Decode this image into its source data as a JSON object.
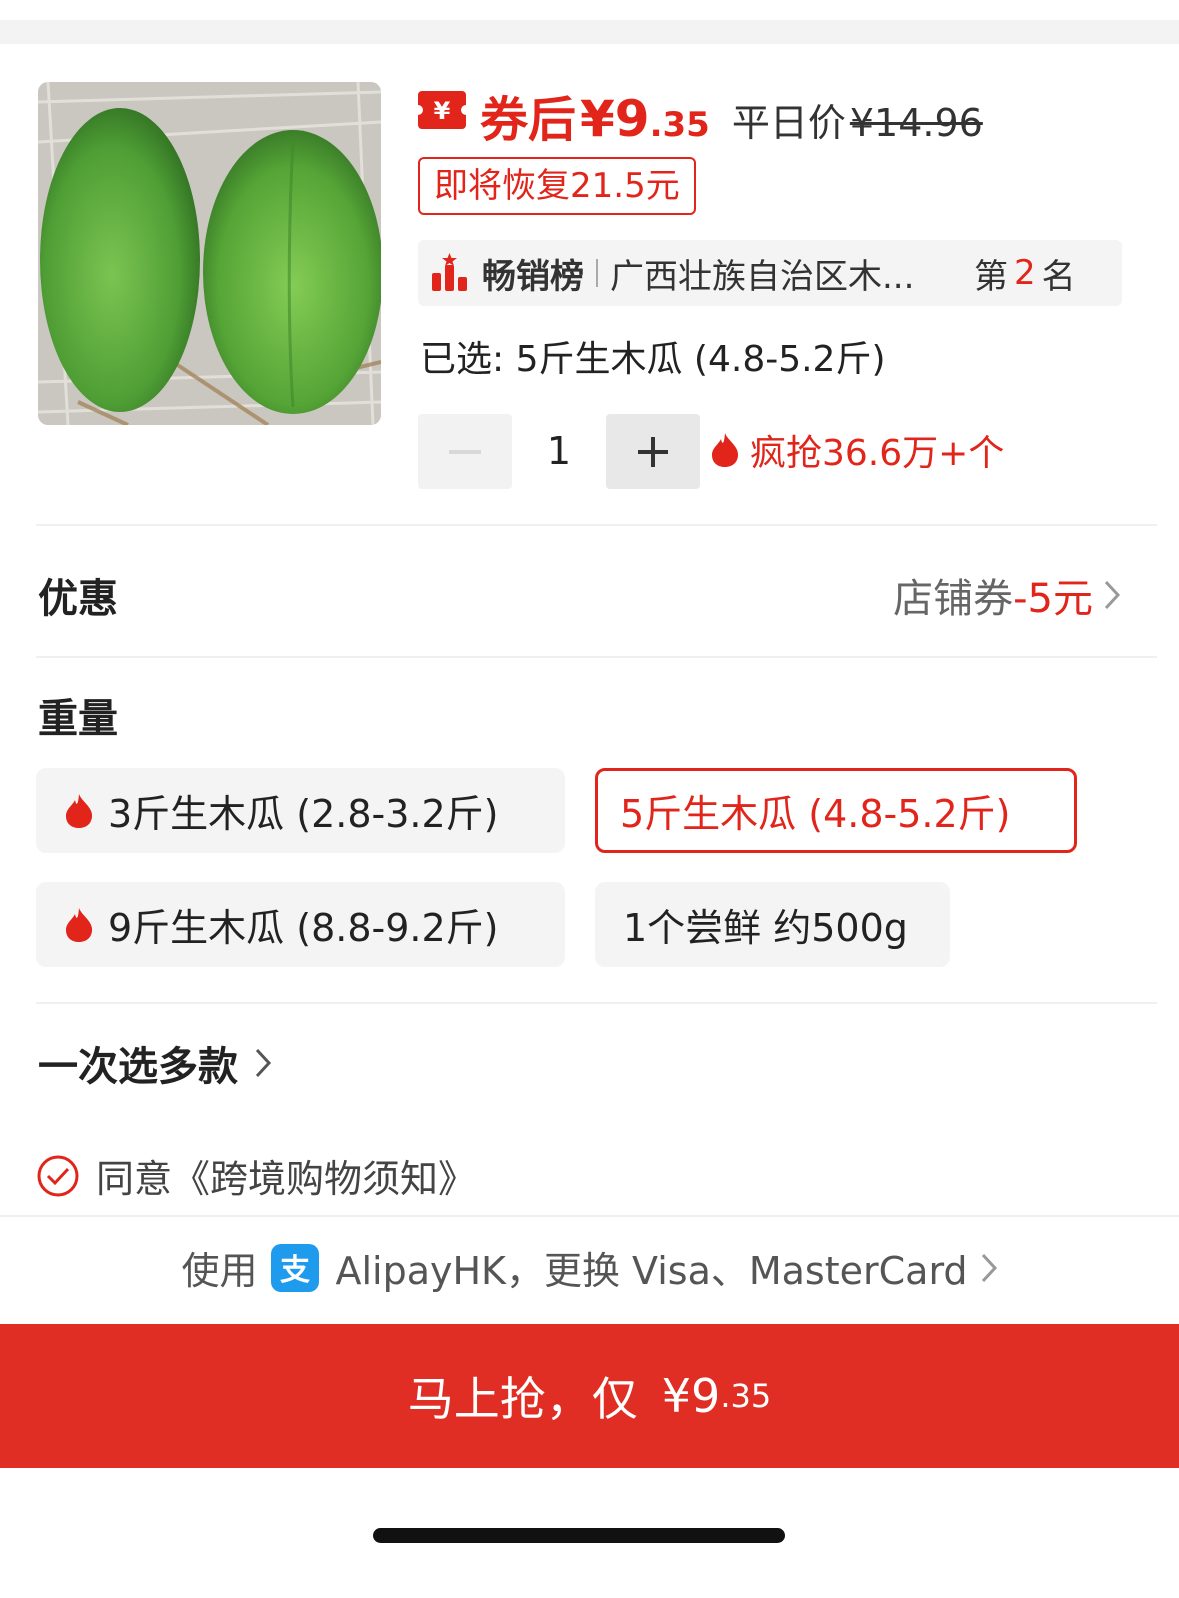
{
  "header": {
    "coupon_price_label": "券后",
    "coupon_price_int": "¥9",
    "coupon_price_dec": ".35",
    "regular_price_label": "平日价",
    "regular_price": "¥14.96",
    "restore_badge": "即将恢复21.5元"
  },
  "ranking": {
    "title": "畅销榜",
    "category": "广西壮族自治区木...",
    "rank_prefix": "第",
    "rank_number": "2",
    "rank_suffix": "名"
  },
  "selection": {
    "selected_text": "已选: 5斤生木瓜 (4.8-5.2斤)"
  },
  "quantity": {
    "value": "1",
    "hot_sales": "疯抢36.6万+个"
  },
  "discount": {
    "title": "优惠",
    "label": "店铺券",
    "amount": "-5元"
  },
  "weight": {
    "title": "重量",
    "options": [
      {
        "label": "3斤生木瓜 (2.8-3.2斤)",
        "hot": true,
        "selected": false
      },
      {
        "label": "5斤生木瓜 (4.8-5.2斤)",
        "hot": false,
        "selected": true
      },
      {
        "label": "9斤生木瓜 (8.8-9.2斤)",
        "hot": true,
        "selected": false
      },
      {
        "label": "1个尝鲜 约500g",
        "hot": false,
        "selected": false
      }
    ]
  },
  "multi_select": "一次选多款",
  "agreement": "同意《跨境购物须知》",
  "payment": {
    "prefix": "使用",
    "method": "AlipayHK，更换 Visa、MasterCard"
  },
  "cta": {
    "label": "马上抢，仅",
    "price_int": "¥9",
    "price_dec": ".35"
  },
  "colors": {
    "accent": "#e1251b",
    "cta_background": "#e02e24"
  }
}
